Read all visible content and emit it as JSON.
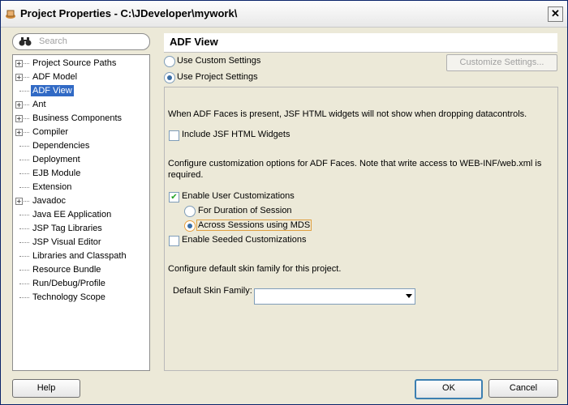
{
  "window": {
    "title": "Project Properties - C:\\JDeveloper\\mywork\\"
  },
  "search": {
    "placeholder": "Search"
  },
  "tree": {
    "items": [
      {
        "label": "Project Source Paths",
        "expandable": true
      },
      {
        "label": "ADF Model",
        "expandable": true
      },
      {
        "label": "ADF View",
        "expandable": false,
        "selected": true
      },
      {
        "label": "Ant",
        "expandable": true
      },
      {
        "label": "Business Components",
        "expandable": true
      },
      {
        "label": "Compiler",
        "expandable": true
      },
      {
        "label": "Dependencies",
        "expandable": false
      },
      {
        "label": "Deployment",
        "expandable": false
      },
      {
        "label": "EJB Module",
        "expandable": false
      },
      {
        "label": "Extension",
        "expandable": false
      },
      {
        "label": "Javadoc",
        "expandable": true
      },
      {
        "label": "Java EE Application",
        "expandable": false
      },
      {
        "label": "JSP Tag Libraries",
        "expandable": false
      },
      {
        "label": "JSP Visual Editor",
        "expandable": false
      },
      {
        "label": "Libraries and Classpath",
        "expandable": false
      },
      {
        "label": "Resource Bundle",
        "expandable": false
      },
      {
        "label": "Run/Debug/Profile",
        "expandable": false
      },
      {
        "label": "Technology Scope",
        "expandable": false
      }
    ]
  },
  "panel": {
    "title": "ADF View",
    "use_custom_label": "Use Custom Settings",
    "use_project_label": "Use Project Settings",
    "customize_button": "Customize Settings...",
    "jsf_info": "When ADF Faces is present, JSF HTML widgets will not show when dropping datacontrols.",
    "include_jsf_label": "Include JSF HTML Widgets",
    "customization_info_1": "Configure customization options for ADF Faces. Note that write access to WEB-INF/web.xml is",
    "customization_info_2": "required.",
    "enable_user_cust_label": "Enable User Customizations",
    "duration_session_label": "For Duration of Session",
    "across_sessions_label": "Across Sessions using MDS",
    "enable_seeded_label": "Enable Seeded Customizations",
    "skin_info": "Configure default skin family for this project.",
    "skin_family_label": "Default Skin Family:",
    "skin_family_value": ""
  },
  "buttons": {
    "help": "Help",
    "ok": "OK",
    "cancel": "Cancel"
  }
}
